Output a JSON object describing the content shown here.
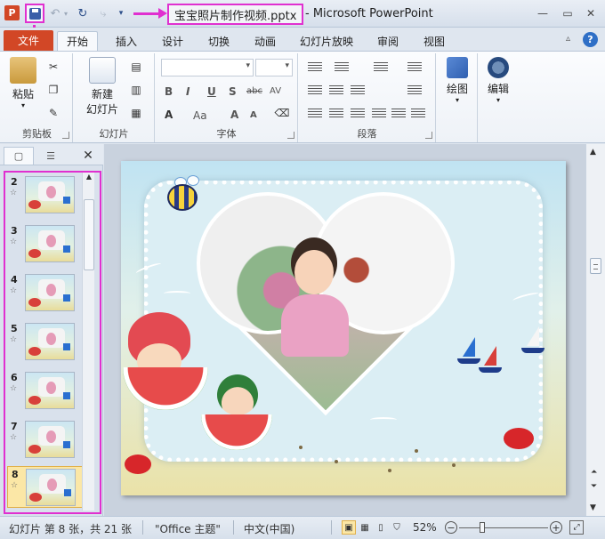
{
  "title_bar": {
    "document_name": "宝宝照片制作视频.pptx",
    "separator": "-",
    "app_name": "Microsoft PowerPoint"
  },
  "quick_access": {
    "icons": [
      "powerpoint-app-icon",
      "save-icon",
      "undo-icon",
      "redo-icon",
      "repeat-icon",
      "customize-qat-icon"
    ]
  },
  "tabs": {
    "file": "文件",
    "items": [
      "开始",
      "插入",
      "设计",
      "切换",
      "动画",
      "幻灯片放映",
      "审阅",
      "视图"
    ],
    "active": "开始"
  },
  "ribbon": {
    "clipboard": {
      "paste": "粘贴",
      "label": "剪贴板"
    },
    "slides": {
      "new_slide_line1": "新建",
      "new_slide_line2": "幻灯片",
      "label": "幻灯片"
    },
    "font": {
      "label": "字体",
      "bold": "B",
      "italic": "I",
      "underline": "U",
      "shadow": "S",
      "strike": "abc",
      "spacing": "AV",
      "font_color": "A",
      "case": "Aa",
      "grow": "A",
      "shrink": "A"
    },
    "paragraph": {
      "label": "段落"
    },
    "drawing": {
      "label": "绘图"
    },
    "editing": {
      "label": "编辑"
    }
  },
  "slide_pane": {
    "thumbnails": [
      {
        "number": "2",
        "star": "☆"
      },
      {
        "number": "3",
        "star": "☆"
      },
      {
        "number": "4",
        "star": "☆"
      },
      {
        "number": "5",
        "star": "☆"
      },
      {
        "number": "6",
        "star": "☆"
      },
      {
        "number": "7",
        "star": "☆"
      },
      {
        "number": "8",
        "star": "☆"
      }
    ],
    "selected": "8"
  },
  "status_bar": {
    "slide_info": "幻灯片 第 8 张，共 21 张",
    "theme": "\"Office 主题\"",
    "language": "中文(中国)",
    "zoom": "52%"
  },
  "colors": {
    "file_tab": "#d24726",
    "annotation_highlight": "#e030d0",
    "selected_thumbnail": "#fbe7a6"
  }
}
